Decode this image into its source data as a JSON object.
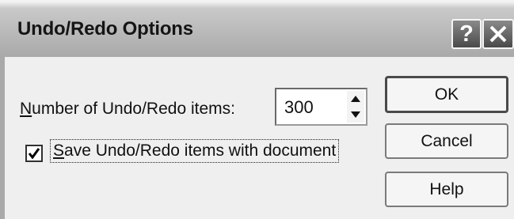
{
  "window": {
    "title": "Undo/Redo Options",
    "help_button_glyph": "?",
    "close_button_icon": "close-icon"
  },
  "dialog": {
    "items_label_accel": "N",
    "items_label_rest": "umber of Undo/Redo items:",
    "items_count_value": "300",
    "save_checkbox_checked": true,
    "save_label_accel": "S",
    "save_label_rest": "ave Undo/Redo items with document"
  },
  "buttons": {
    "ok_label": "OK",
    "cancel_label": "Cancel",
    "help_label": "Help"
  }
}
